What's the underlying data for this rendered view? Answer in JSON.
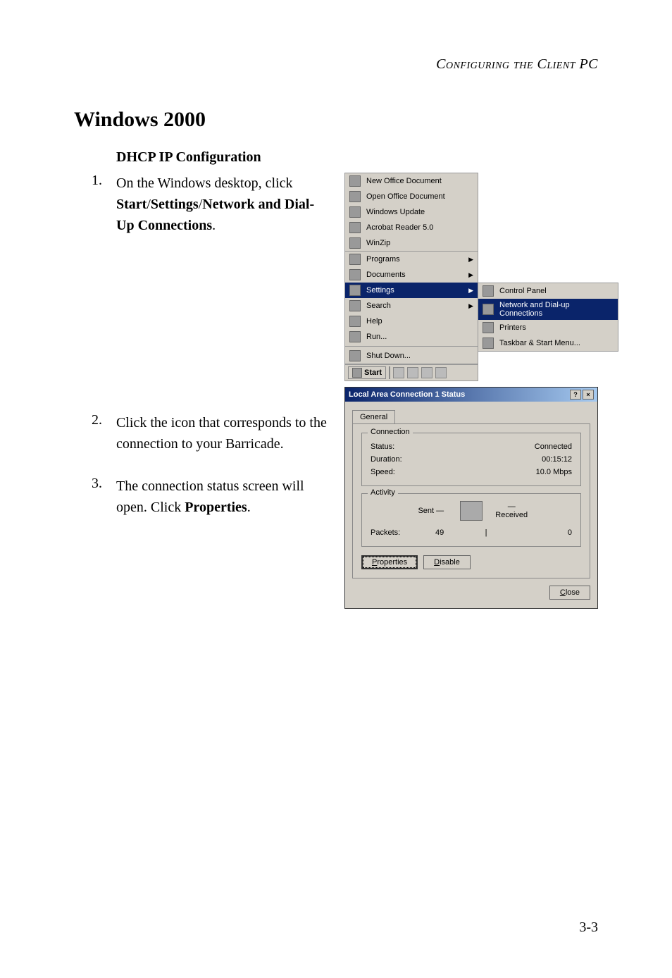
{
  "header": {
    "title": "Configuring the Client PC"
  },
  "section": {
    "main_heading": "Windows 2000",
    "sub_heading": "DHCP IP Configuration"
  },
  "steps": [
    {
      "num": "1.",
      "html": "On the Windows desktop, click <b>Start</b>/<b>Settings</b>/<b>Network and Dial-Up Connections</b>."
    },
    {
      "num": "2.",
      "html": "Click the icon that corresponds to the connection to your Barricade."
    },
    {
      "num": "3.",
      "html": "The connection status screen will open. Click <b>Properties</b>."
    }
  ],
  "start_menu": {
    "top_items": [
      "New Office Document",
      "Open Office Document",
      "Windows Update",
      "Acrobat Reader 5.0",
      "WinZip"
    ],
    "bottom_items": [
      {
        "label": "Programs",
        "arrow": true
      },
      {
        "label": "Documents",
        "arrow": true
      },
      {
        "label": "Settings",
        "arrow": true,
        "highlight": true,
        "submenu": true
      },
      {
        "label": "Search",
        "arrow": true
      },
      {
        "label": "Help"
      },
      {
        "label": "Run..."
      }
    ],
    "shutdown": "Shut Down...",
    "settings_submenu": [
      "Control Panel",
      "Network and Dial-up Connections",
      "Printers",
      "Taskbar & Start Menu..."
    ],
    "sub_highlight_index": 1,
    "taskbar": {
      "start": "Start"
    }
  },
  "status_dialog": {
    "title": "Local Area Connection 1 Status",
    "tab": "General",
    "connection": {
      "label": "Connection",
      "rows": [
        {
          "k": "Status:",
          "v": "Connected"
        },
        {
          "k": "Duration:",
          "v": "00:15:12"
        },
        {
          "k": "Speed:",
          "v": "10.0 Mbps"
        }
      ]
    },
    "activity": {
      "label": "Activity",
      "sent": "Sent",
      "received": "Received",
      "packets_label": "Packets:",
      "sent_val": "49",
      "recv_val": "0"
    },
    "buttons": {
      "properties": "Properties",
      "disable": "Disable",
      "close": "Close"
    }
  },
  "page_number": "3-3"
}
